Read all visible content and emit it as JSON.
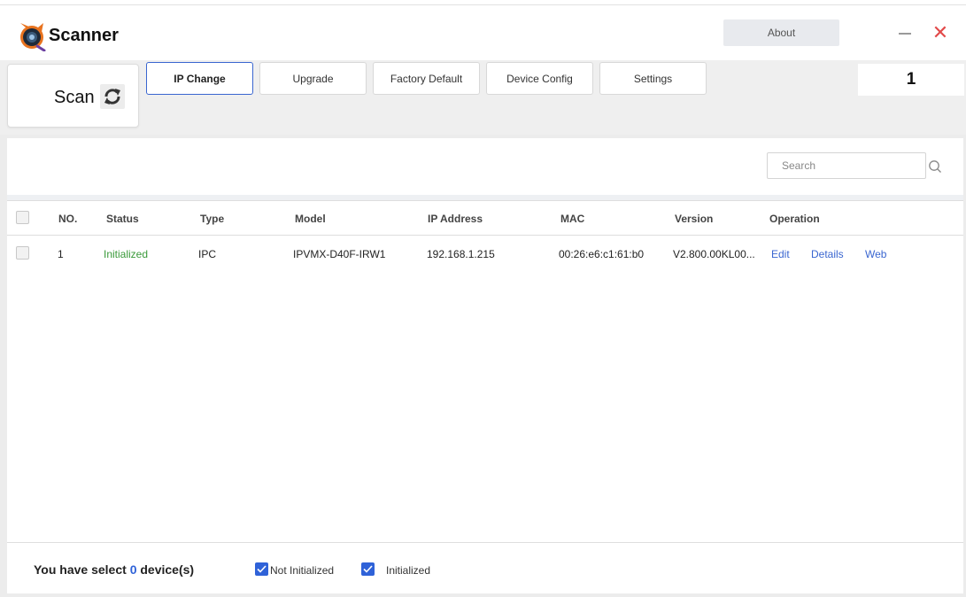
{
  "app": {
    "title": "Scanner",
    "about_label": "About",
    "device_count": "1"
  },
  "toolbar": {
    "scan_label": "Scan",
    "buttons": [
      {
        "label": "IP Change",
        "active": true
      },
      {
        "label": "Upgrade",
        "active": false
      },
      {
        "label": "Factory Default",
        "active": false
      },
      {
        "label": "Device Config",
        "active": false
      },
      {
        "label": "Settings",
        "active": false
      }
    ]
  },
  "search": {
    "placeholder": "Search"
  },
  "table": {
    "columns": [
      "NO.",
      "Status",
      "Type",
      "Model",
      "IP Address",
      "MAC",
      "Version",
      "Operation"
    ],
    "rows": [
      {
        "no": "1",
        "status": "Initialized",
        "type": "IPC",
        "model": "IPVMX-D40F-IRW1",
        "ip": "192.168.1.215",
        "mac": "00:26:e6:c1:61:b0",
        "version": "V2.800.00KL00...",
        "operations": [
          "Edit",
          "Details",
          "Web"
        ]
      }
    ]
  },
  "footer": {
    "select_prefix": "You have select",
    "select_count": "0",
    "select_suffix": "device(s)",
    "legend": [
      {
        "label": "Not Initialized",
        "checked": true
      },
      {
        "label": "Initialized",
        "checked": true
      }
    ]
  },
  "colors": {
    "accent": "#2f62d8",
    "status_ok": "#3a9a3a",
    "close": "#e24a4a"
  }
}
